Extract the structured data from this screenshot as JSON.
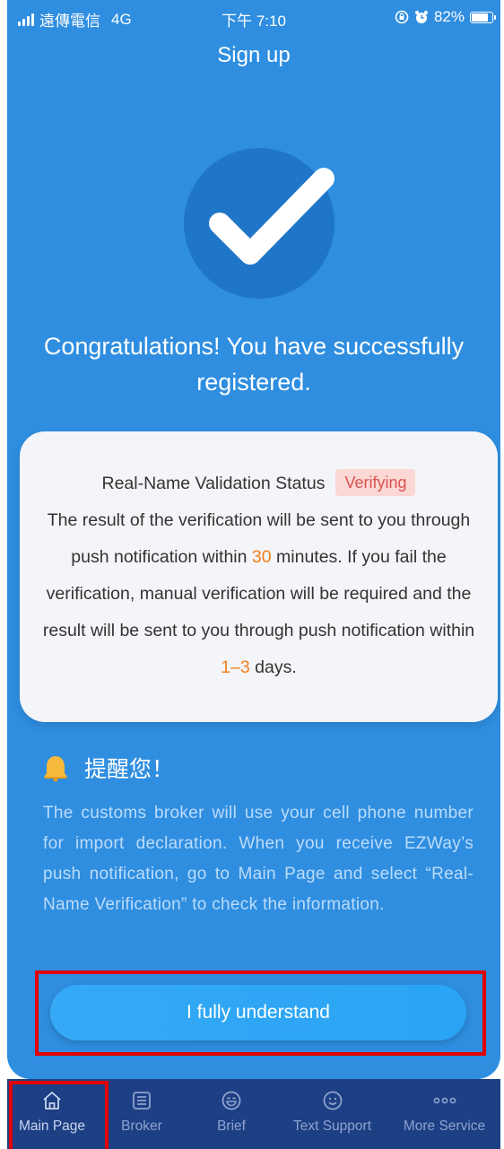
{
  "status_bar": {
    "carrier": "遠傳電信",
    "network": "4G",
    "time": "下午 7:10",
    "battery": "82%",
    "battery_level": 0.82
  },
  "header": {
    "title": "Sign up"
  },
  "success": {
    "icon": "check-icon",
    "message": "Congratulations! You have successfully registered."
  },
  "info_card": {
    "status_label": "Real-Name Validation Status",
    "status_badge": "Verifying",
    "text_part1": "The result of the verification will be sent to you through push notification within ",
    "minutes_value": "30",
    "text_part2": " minutes. If you fail the verification, manual verification will be required and the result will be sent to you through push notification within ",
    "days_value": "1–3",
    "text_part3": " days."
  },
  "reminder": {
    "icon": "bell-icon",
    "title": "提醒您！",
    "body": "The customs broker will use your cell phone number for import declaration. When you receive EZWay’s push notification, go to Main Page and select “Real-Name Verification” to check the information."
  },
  "actions": {
    "confirm_label": "I fully understand"
  },
  "tab_bar": {
    "items": [
      {
        "label": "Main Page",
        "icon": "home-icon",
        "active": true
      },
      {
        "label": "Broker",
        "icon": "list-icon",
        "active": false
      },
      {
        "label": "Brief",
        "icon": "smile-icon",
        "active": false
      },
      {
        "label": "Text Support",
        "icon": "chat-smile-icon",
        "active": false
      },
      {
        "label": "More Service",
        "icon": "more-icon",
        "active": false
      }
    ]
  },
  "colors": {
    "background": "#2f8ee0",
    "tab_bar": "#1d3f84",
    "highlight": "#f07f1a",
    "badge_bg": "#fbd7d5",
    "badge_text": "#d9534f",
    "annotation": "#e00000"
  }
}
